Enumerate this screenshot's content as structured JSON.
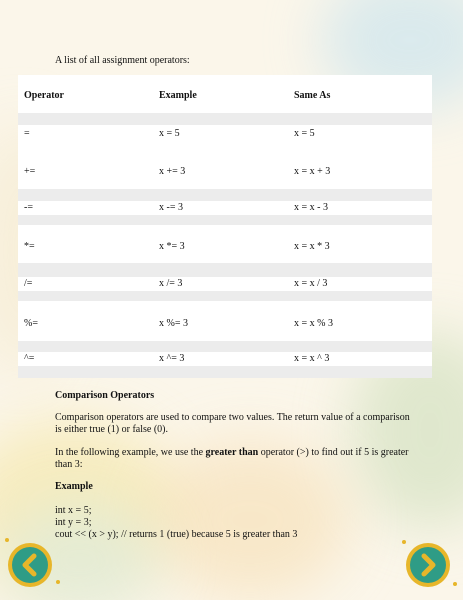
{
  "intro": "A list of all assignment operators:",
  "table": {
    "headers": [
      "Operator",
      "Example",
      "Same As"
    ],
    "rows": [
      [
        "=",
        "x = 5",
        "x = 5"
      ],
      [
        "+=",
        "x += 3",
        "x = x + 3"
      ],
      [
        "-=",
        "x -= 3",
        "x = x - 3"
      ],
      [
        "*=",
        "x *= 3",
        "x = x * 3"
      ],
      [
        "/=",
        "x /= 3",
        "x = x / 3"
      ],
      [
        "%=",
        "x %= 3",
        "x = x % 3"
      ],
      [
        "^=",
        "x ^= 3",
        "x = x ^ 3"
      ]
    ]
  },
  "comparison": {
    "title": "Comparison Operators",
    "para1": "Comparison operators are used to compare two values. The return value of a comparison is either true (1) or false (0).",
    "para2_before": "In the following example, we use the ",
    "para2_bold": "greater than",
    "para2_after": " operator (>) to find out if 5 is greater than 3:",
    "example_heading": "Example",
    "code": [
      "int x = 5;",
      "int y = 3;",
      "cout << (x > y); // returns 1 (true) because 5 is greater than 3"
    ]
  },
  "nav": {
    "prev_icon": "chevron-left-icon",
    "next_icon": "chevron-right-icon"
  },
  "colors": {
    "button_ring": "#e7b62a",
    "button_fill": "#2f9c86"
  }
}
